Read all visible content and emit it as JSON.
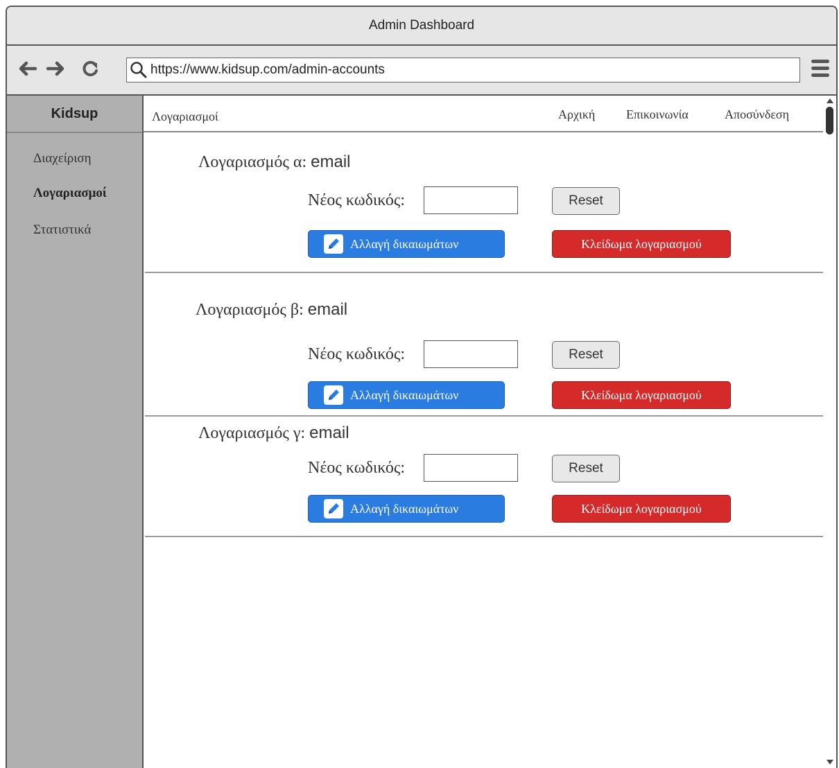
{
  "window": {
    "title": "Admin Dashboard"
  },
  "browser": {
    "url": "https://www.kidsup.com/admin-accounts"
  },
  "sidebar": {
    "brand": "Kidsup",
    "items": [
      {
        "label": "Διαχείριση"
      },
      {
        "label": "Λογαριασμοί",
        "active": true
      },
      {
        "label": "Στατιστικά"
      }
    ]
  },
  "topnav": {
    "breadcrumb": "Λογαριασμοί",
    "links": [
      "Αρχική",
      "Επικοινωνία",
      "Αποσύνδεση"
    ]
  },
  "accounts": [
    {
      "title": "Λογαριασμός α:",
      "email": "email",
      "password_label": "Νέος κωδικός:",
      "password_value": "",
      "reset_label": "Reset",
      "permissions_label": "Αλλαγή δικαιωμάτων",
      "lock_label": "Κλείδωμα λογαριασμού"
    },
    {
      "title": "Λογαριασμός β:",
      "email": "email",
      "password_label": "Νέος κωδικός:",
      "password_value": "",
      "reset_label": "Reset",
      "permissions_label": "Αλλαγή δικαιωμάτων",
      "lock_label": "Κλείδωμα λογαριασμού"
    },
    {
      "title": "Λογαριασμός γ:",
      "email": "email",
      "password_label": "Νέος κωδικός:",
      "password_value": "",
      "reset_label": "Reset",
      "permissions_label": "Αλλαγή δικαιωμάτων",
      "lock_label": "Κλείδωμα λογαριασμού"
    }
  ],
  "colors": {
    "permissions_button": "#2a7ce0",
    "lock_button": "#d42a2a",
    "sidebar": "#b0b0b0",
    "chrome": "#e6e6e6"
  },
  "icons": {
    "back": "arrow-left-icon",
    "forward": "arrow-right-icon",
    "reload": "reload-icon",
    "search": "search-icon",
    "menu": "hamburger-menu-icon",
    "edit": "pencil-icon"
  }
}
